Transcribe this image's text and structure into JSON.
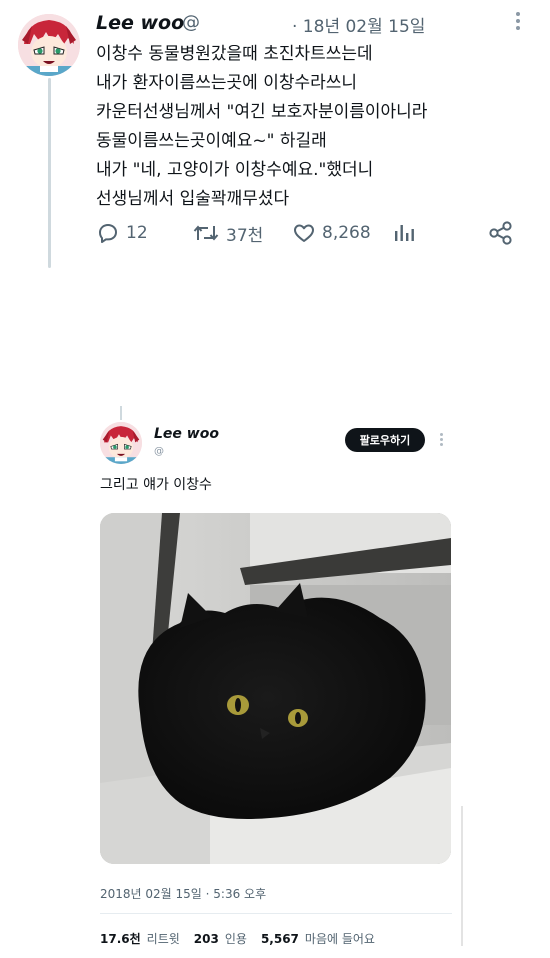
{
  "tweet": {
    "author_name": "Lee woo",
    "author_handle": "@",
    "date": "· 18년 02월 15일",
    "body": "이창수 동물병원갔을때 초진차트쓰는데\n내가 환자이름쓰는곳에 이창수라쓰니\n카운터선생님께서 \"여긴 보호자분이름이아니라\n동물이름쓰는곳이예요~\" 하길래\n내가 \"네, 고양이가 이창수예요.\"했더니\n선생님께서 입술꽉깨무셨다",
    "replies": "12",
    "retweets": "37천",
    "likes": "8,268",
    "icons": {
      "reply": "reply-icon",
      "retweet": "retweet-icon",
      "like": "heart-icon",
      "stats": "stats-icon",
      "share": "share-icon",
      "more": "more-icon"
    }
  },
  "quoted_tweet": {
    "author_name": "Lee woo",
    "author_handle": "@",
    "follow_label": "팔로우하기",
    "text": "그리고 얘가 이창수",
    "timestamp": "2018년 02월 15일 · 5:36 오후",
    "retweets_count": "17.6천",
    "retweets_label": "리트윗",
    "quotes_count": "203",
    "quotes_label": "인용",
    "likes_count": "5,567",
    "likes_label": "마음에 들어요"
  },
  "colors": {
    "text_primary": "#0f1419",
    "text_secondary": "#536471",
    "follow_button_bg": "#0f1419",
    "thread_line": "#cfd9de"
  }
}
